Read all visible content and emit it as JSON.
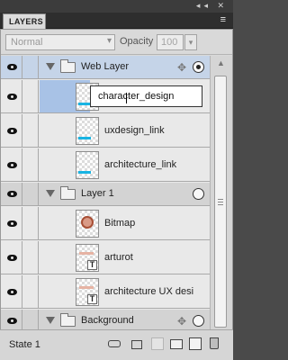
{
  "window": {
    "icons": "◂◂ ✕"
  },
  "panel": {
    "tab_label": "LAYERS",
    "menu_icon": "≡"
  },
  "controls": {
    "blend_mode": "Normal",
    "opacity_label": "Opacity",
    "opacity_value": "100"
  },
  "layers": {
    "web_layer": {
      "name": "Web Layer"
    },
    "rename_value": "character_design",
    "l2": {
      "name": "uxdesign_link"
    },
    "l3": {
      "name": "architecture_link"
    },
    "layer1": {
      "name": "Layer 1"
    },
    "l5": {
      "name": "Bitmap"
    },
    "l6": {
      "name": "arturot"
    },
    "l7": {
      "name": "architecture UX desi"
    },
    "background": {
      "name": "Background"
    }
  },
  "footer": {
    "state": "State 1"
  },
  "colors": {
    "selection": "#a8c2e6",
    "accent_cyan": "#18b4e3"
  }
}
